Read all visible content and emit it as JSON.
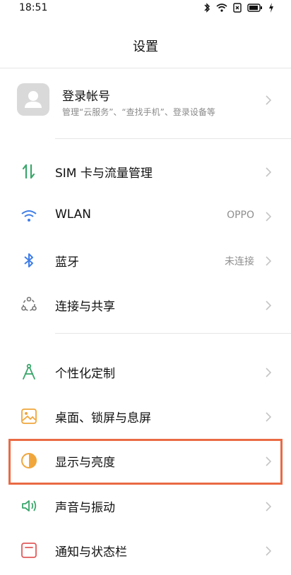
{
  "status_bar": {
    "time": "18:51"
  },
  "header": {
    "title": "设置"
  },
  "account": {
    "title": "登录帐号",
    "subtitle": "管理“云服务”、“查找手机”、登录设备等"
  },
  "rows": [
    {
      "label": "SIM 卡与流量管理",
      "value": "",
      "icon": "sim-data-icon"
    },
    {
      "label": "WLAN",
      "value": "OPPO",
      "icon": "wifi-icon"
    },
    {
      "label": "蓝牙",
      "value": "未连接",
      "icon": "bluetooth-icon"
    },
    {
      "label": "连接与共享",
      "value": "",
      "icon": "share-icon"
    },
    {
      "label": "个性化定制",
      "value": "",
      "icon": "personalize-icon"
    },
    {
      "label": "桌面、锁屏与息屏",
      "value": "",
      "icon": "wallpaper-icon"
    },
    {
      "label": "显示与亮度",
      "value": "",
      "icon": "display-brightness-icon"
    },
    {
      "label": "声音与振动",
      "value": "",
      "icon": "sound-icon"
    },
    {
      "label": "通知与状态栏",
      "value": "",
      "icon": "notification-icon"
    }
  ],
  "colors": {
    "highlight": "#ea6a44",
    "green": "#3aa66b",
    "blue": "#3f7ee8",
    "orange": "#f0a63b"
  }
}
